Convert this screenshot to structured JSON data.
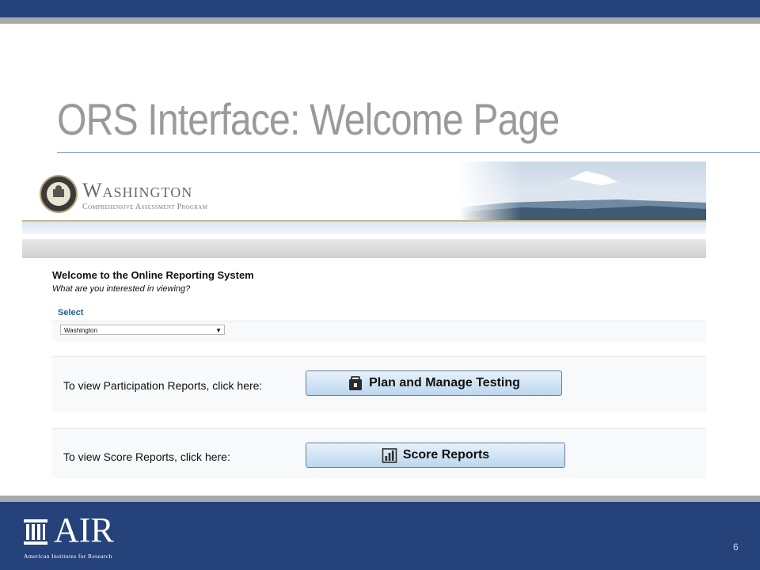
{
  "slide": {
    "title": "ORS Interface: Welcome Page",
    "page_number": "6"
  },
  "banner": {
    "state_name": "Washington",
    "program_name": "Comprehensive Assessment Program"
  },
  "welcome": {
    "heading": "Welcome to the Online Reporting System",
    "question": "What are you interested in viewing?"
  },
  "select": {
    "label": "Select",
    "selected_value": "Washington"
  },
  "participation": {
    "text": "To view Participation Reports, click here:",
    "button_label": "Plan and Manage Testing",
    "icon": "lock-folder-icon"
  },
  "score": {
    "text": "To view Score Reports, click here:",
    "button_label": "Score Reports",
    "icon": "bar-chart-icon"
  },
  "footer": {
    "logo_text": "AIR",
    "logo_subtitle": "American Institutes for Research"
  },
  "colors": {
    "brand_navy": "#25427a",
    "title_grey": "#9a9a9a",
    "select_label_blue": "#1f5d9a",
    "button_blue": "#bcd7ee"
  }
}
